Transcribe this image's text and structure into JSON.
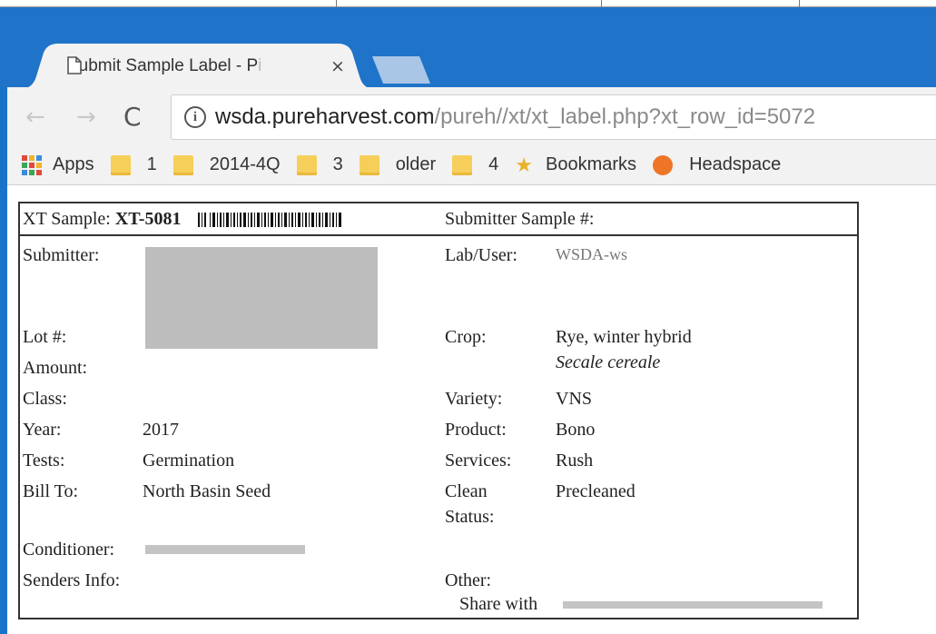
{
  "tab": {
    "title": "Submit Sample Label - P",
    "title_fade": "i",
    "close": "×"
  },
  "nav": {
    "back": "←",
    "forward": "→",
    "reload": "C"
  },
  "address": {
    "host": "wsda.pureharvest.com",
    "path": "/pureh//xt/xt_label.php?xt_row_id=5072"
  },
  "bookmarks": {
    "apps": "Apps",
    "items": [
      "1",
      "2014-4Q",
      "3",
      "older",
      "4"
    ],
    "starred": "Bookmarks",
    "last": "Headspace"
  },
  "label": {
    "header": {
      "sample_label": "XT Sample:",
      "sample_id": "XT-5081",
      "submitter_sample": "Submitter Sample #:"
    },
    "left": {
      "submitter": "Submitter:",
      "lot": "Lot #:",
      "amount": "Amount:",
      "class": "Class:",
      "year": "Year:",
      "year_val": "2017",
      "tests": "Tests:",
      "tests_val": "Germination",
      "bill_to": "Bill To:",
      "bill_to_val": "North Basin Seed",
      "conditioner": "Conditioner:",
      "senders_info": "Senders Info:"
    },
    "right": {
      "lab_user": "Lab/User:",
      "lab_user_val": "WSDA-ws",
      "crop": "Crop:",
      "crop_val": "Rye, winter hybrid",
      "crop_sci": "Secale cereale",
      "variety": "Variety:",
      "variety_val": "VNS",
      "product": "Product:",
      "product_val": "Bono",
      "services": "Services:",
      "services_val": "Rush",
      "clean_status_1": "Clean",
      "clean_status_2": "Status:",
      "clean_val": "Precleaned",
      "other": "Other:",
      "share_with": "Share with"
    }
  },
  "colors": {
    "chrome_blue": "#1f74c9",
    "toolbar_bg": "#f2f2f2",
    "folder": "#f5cf59",
    "headspace_dot": "#ee7427"
  }
}
